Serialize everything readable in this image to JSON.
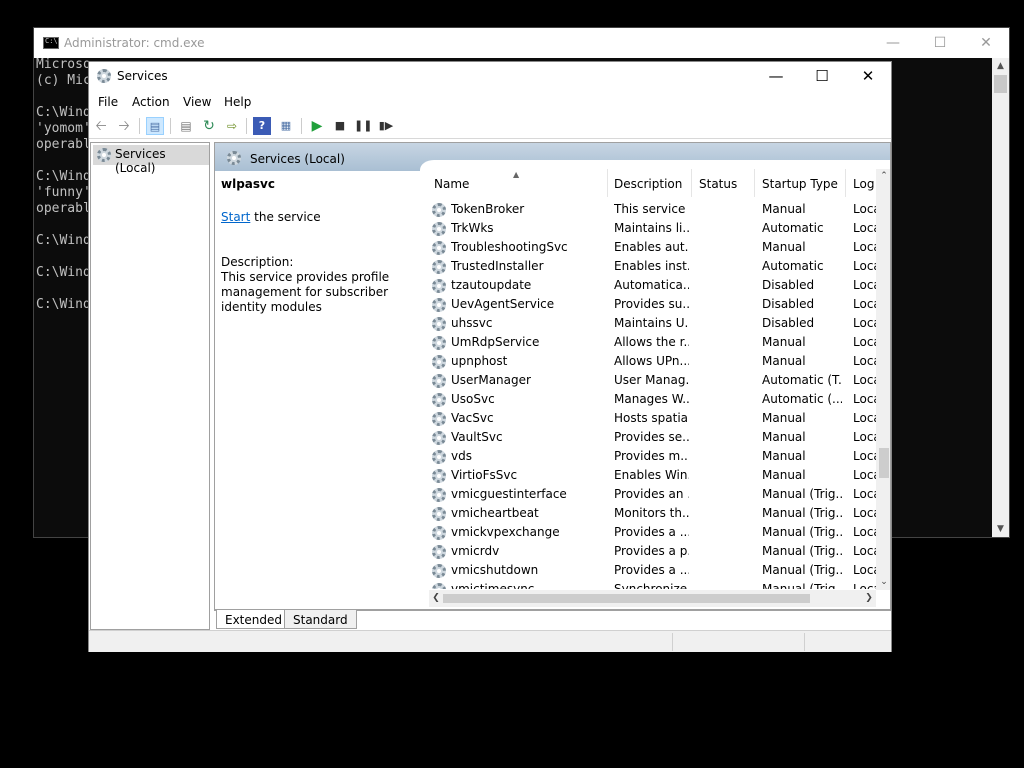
{
  "cmd": {
    "title": "Administrator: cmd.exe",
    "lines": [
      "Microso",
      "(c) Mic",
      "",
      "C:\\Wind",
      "'yomom'",
      "operabl",
      "",
      "C:\\Wind",
      "'funny'",
      "operabl",
      "",
      "C:\\Wind",
      "",
      "C:\\Wind",
      "",
      "C:\\Wind"
    ]
  },
  "services": {
    "title": "Services",
    "menu": [
      "File",
      "Action",
      "View",
      "Help"
    ],
    "tree_item": "Services (Local)",
    "header": "Services (Local)",
    "selected_service": "wlpasvc",
    "start_link": "Start",
    "start_suffix": " the service",
    "description_label": "Description:",
    "description": "This service provides profile management for subscriber identity modules",
    "columns": [
      "Name",
      "Description",
      "Status",
      "Startup Type",
      "Log"
    ],
    "rows": [
      {
        "name": "TokenBroker",
        "desc": "This service ...",
        "status": "",
        "startup": "Manual",
        "log": "Loca"
      },
      {
        "name": "TrkWks",
        "desc": "Maintains li...",
        "status": "",
        "startup": "Automatic",
        "log": "Loca"
      },
      {
        "name": "TroubleshootingSvc",
        "desc": "Enables aut...",
        "status": "",
        "startup": "Manual",
        "log": "Loca"
      },
      {
        "name": "TrustedInstaller",
        "desc": "Enables inst...",
        "status": "",
        "startup": "Automatic",
        "log": "Loca"
      },
      {
        "name": "tzautoupdate",
        "desc": "Automatica...",
        "status": "",
        "startup": "Disabled",
        "log": "Loca"
      },
      {
        "name": "UevAgentService",
        "desc": "Provides su...",
        "status": "",
        "startup": "Disabled",
        "log": "Loca"
      },
      {
        "name": "uhssvc",
        "desc": "Maintains U...",
        "status": "",
        "startup": "Disabled",
        "log": "Loca"
      },
      {
        "name": "UmRdpService",
        "desc": "Allows the r...",
        "status": "",
        "startup": "Manual",
        "log": "Loca"
      },
      {
        "name": "upnphost",
        "desc": "Allows UPn...",
        "status": "",
        "startup": "Manual",
        "log": "Loca"
      },
      {
        "name": "UserManager",
        "desc": "User Manag...",
        "status": "",
        "startup": "Automatic (T...",
        "log": "Loca"
      },
      {
        "name": "UsoSvc",
        "desc": "Manages W...",
        "status": "",
        "startup": "Automatic (...",
        "log": "Loca"
      },
      {
        "name": "VacSvc",
        "desc": "Hosts spatia...",
        "status": "",
        "startup": "Manual",
        "log": "Loca"
      },
      {
        "name": "VaultSvc",
        "desc": "Provides se...",
        "status": "",
        "startup": "Manual",
        "log": "Loca"
      },
      {
        "name": "vds",
        "desc": "Provides m...",
        "status": "",
        "startup": "Manual",
        "log": "Loca"
      },
      {
        "name": "VirtioFsSvc",
        "desc": "Enables Win...",
        "status": "",
        "startup": "Manual",
        "log": "Loca"
      },
      {
        "name": "vmicguestinterface",
        "desc": "Provides an ...",
        "status": "",
        "startup": "Manual (Trig...",
        "log": "Loca"
      },
      {
        "name": "vmicheartbeat",
        "desc": "Monitors th...",
        "status": "",
        "startup": "Manual (Trig...",
        "log": "Loca"
      },
      {
        "name": "vmickvpexchange",
        "desc": "Provides a ...",
        "status": "",
        "startup": "Manual (Trig...",
        "log": "Loca"
      },
      {
        "name": "vmicrdv",
        "desc": "Provides a p...",
        "status": "",
        "startup": "Manual (Trig...",
        "log": "Loca"
      },
      {
        "name": "vmicshutdown",
        "desc": "Provides a ...",
        "status": "",
        "startup": "Manual (Trig...",
        "log": "Loca"
      },
      {
        "name": "vmictimesync",
        "desc": "Synchronize...",
        "status": "",
        "startup": "Manual (Trig...",
        "log": "Loca"
      }
    ],
    "tabs": [
      "Extended",
      "Standard"
    ]
  }
}
